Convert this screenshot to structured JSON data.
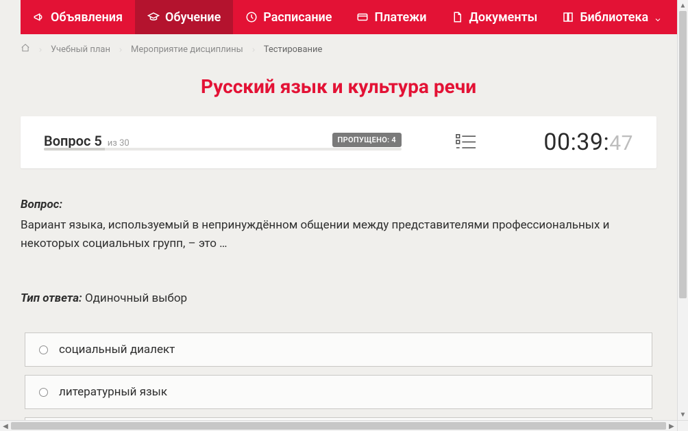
{
  "nav": {
    "items": [
      {
        "label": "Объявления",
        "active": false
      },
      {
        "label": "Обучение",
        "active": true
      },
      {
        "label": "Расписание",
        "active": false
      },
      {
        "label": "Платежи",
        "active": false
      },
      {
        "label": "Документы",
        "active": false
      },
      {
        "label": "Библиотека",
        "active": false,
        "has_chevron": true
      }
    ]
  },
  "breadcrumb": {
    "items": [
      {
        "label": "Учебный план"
      },
      {
        "label": "Мероприятие дисциплины"
      }
    ],
    "current": "Тестирование"
  },
  "page_title": "Русский язык и культура речи",
  "status": {
    "question_label": "Вопрос 5",
    "of_label": "из 30",
    "skipped_label": "ПРОПУЩЕНО: 4",
    "progress_percent": 17
  },
  "timer": {
    "hm": "00:39:",
    "sec": "47"
  },
  "question": {
    "heading": "Вопрос:",
    "text": "Вариант языка, используемый в непринуждённом общении между представителями профессиональных и некоторых социальных групп, – это …",
    "answer_type_label": "Тип ответа:",
    "answer_type_value": " Одиночный выбор"
  },
  "options": [
    {
      "text": "социальный диалект"
    },
    {
      "text": "литературный язык"
    }
  ]
}
